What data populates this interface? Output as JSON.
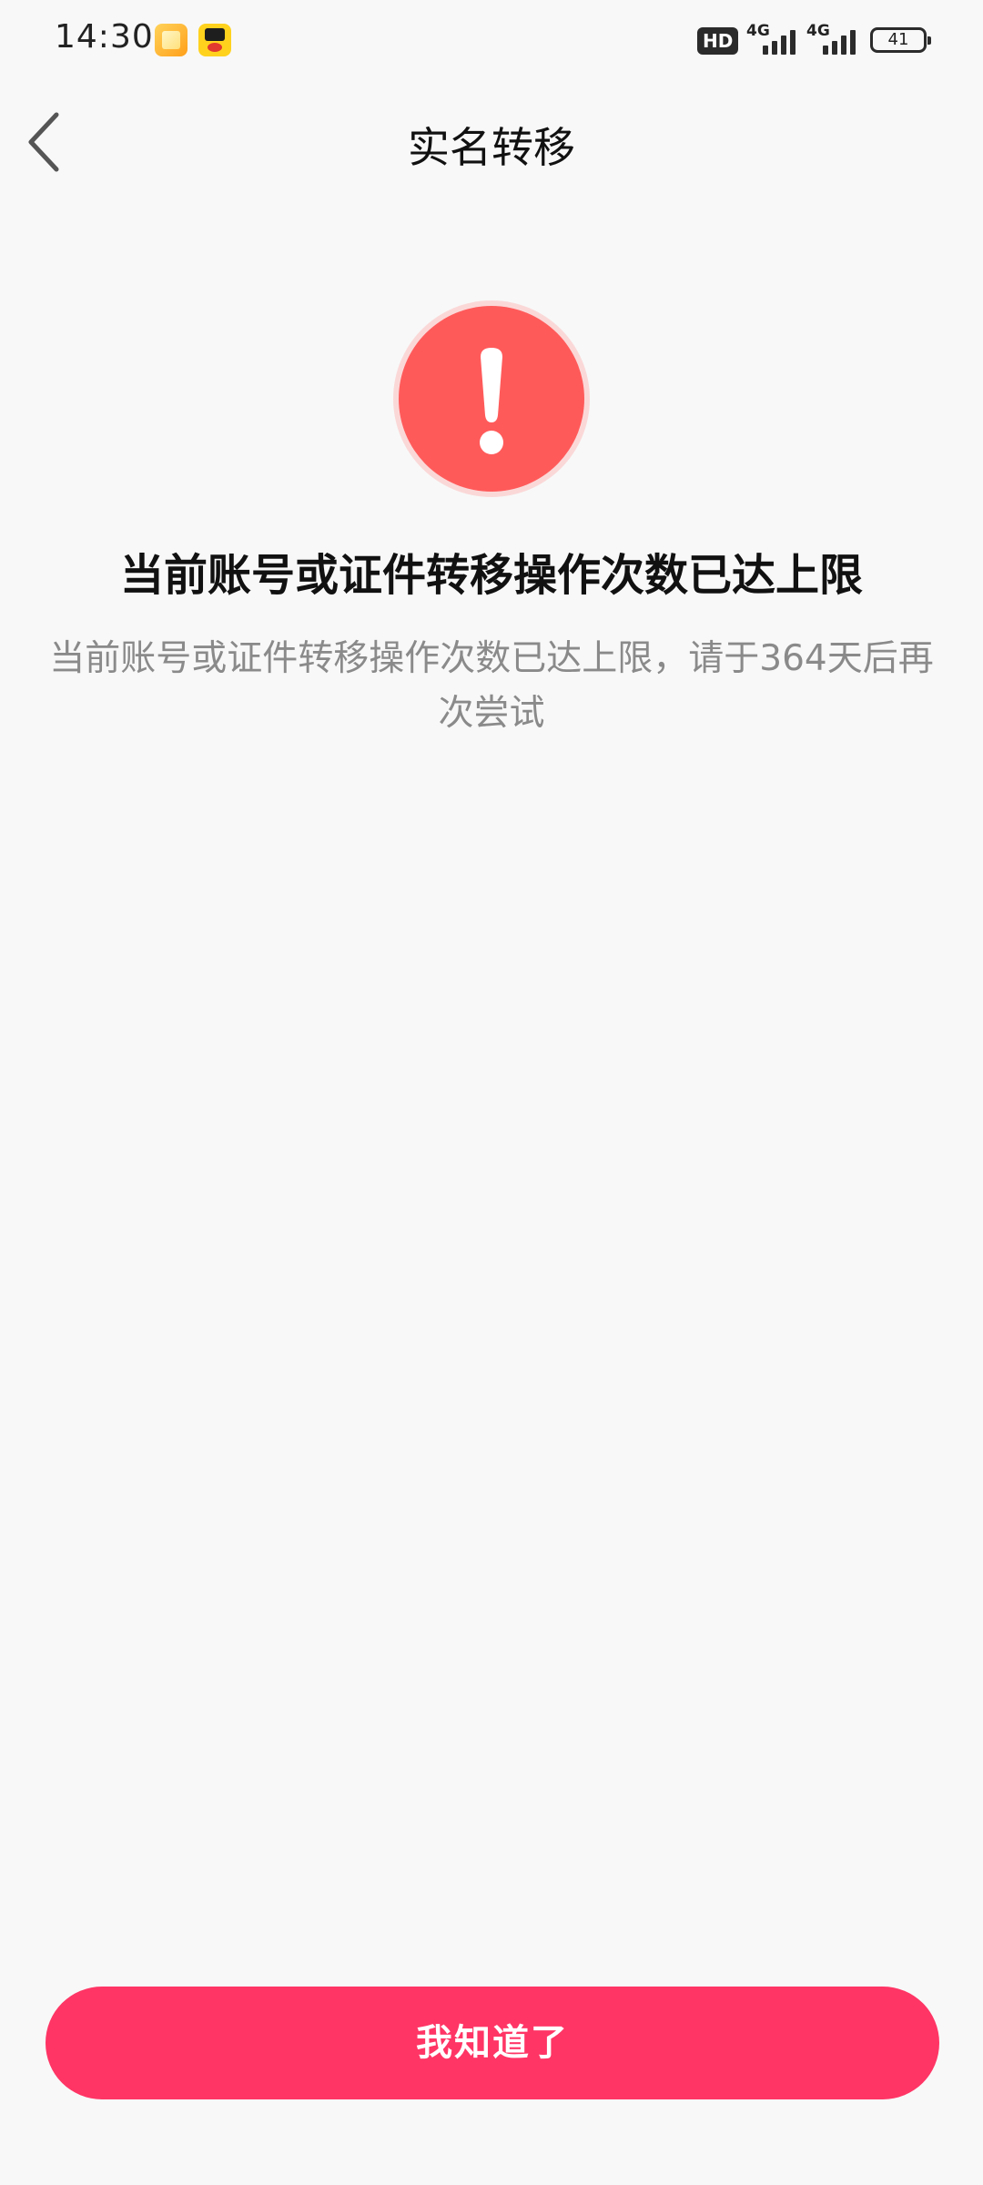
{
  "status_bar": {
    "time": "14:30",
    "notification_icons": [
      "gallery-app-icon",
      "kids-app-icon"
    ],
    "hd_badge": "HD",
    "network_1": "4G",
    "network_2": "4G",
    "battery": "41"
  },
  "nav": {
    "back_icon": "chevron-left-icon",
    "title": "实名转移"
  },
  "result": {
    "icon": "alert-exclamation-icon",
    "title": "当前账号或证件转移操作次数已达上限",
    "description": "当前账号或证件转移操作次数已达上限，请于364天后再次尝试"
  },
  "actions": {
    "confirm_label": "我知道了"
  },
  "colors": {
    "background": "#f8f8f8",
    "alert_red": "#ff5a5a",
    "alert_ring": "#fbd8d8",
    "button_pink": "#ff3565",
    "title_text": "#111111",
    "secondary_text": "#8a8a8a"
  }
}
